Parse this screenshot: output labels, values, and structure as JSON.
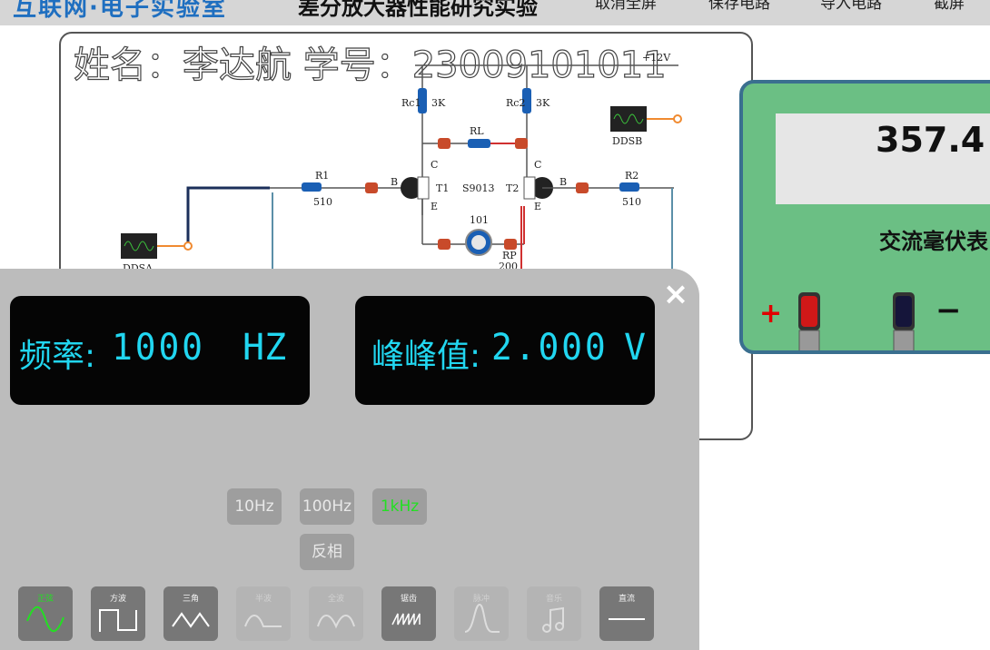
{
  "topbar": {
    "brand": "互联网·电子实验室",
    "experiment_title": "差分放大器性能研究实验",
    "menu": [
      "取消全屏",
      "保存电路",
      "导入电路",
      "截屏"
    ]
  },
  "board": {
    "student_name_label": "姓名：",
    "student_name": "李达航",
    "student_id_label": "学号：",
    "student_id": "23009101011",
    "supply_label": "+12V",
    "components": {
      "rc1": "Rc1",
      "rc1_value": "3K",
      "rc2": "Rc2",
      "rc2_value": "3K",
      "rl": "RL",
      "r1": "R1",
      "r1_value": "510",
      "r2": "R2",
      "r2_value": "510",
      "transistor": "S9013",
      "t1": "T1",
      "t2": "T2",
      "rp": "RP",
      "rp_value": "200",
      "pot_code": "101",
      "b": "B",
      "c": "C",
      "e": "E",
      "ddsa": "DDSA",
      "ddsb": "DDSB"
    }
  },
  "meter": {
    "reading": "357.4",
    "name": "交流毫伏表",
    "plus": "+",
    "minus": "−",
    "colors": {
      "body": "#6bbf84",
      "frame": "#3a6f8f"
    }
  },
  "generator": {
    "close": "×",
    "freq_label": "频率:",
    "freq_value": "1000",
    "freq_unit": "HZ",
    "amp_label": "峰峰值:",
    "amp_value": "2.000",
    "amp_unit": "V",
    "range_buttons": [
      "10Hz",
      "100Hz",
      "1kHz"
    ],
    "active_range": "1kHz",
    "invert_label": "反相",
    "waveforms": [
      {
        "label": "正弦",
        "icon": "sine-wave-icon",
        "state": "active"
      },
      {
        "label": "方波",
        "icon": "square-wave-icon",
        "state": "enabled"
      },
      {
        "label": "三角",
        "icon": "triangle-wave-icon",
        "state": "enabled"
      },
      {
        "label": "半波",
        "icon": "half-wave-icon",
        "state": "disabled"
      },
      {
        "label": "全波",
        "icon": "full-wave-icon",
        "state": "disabled"
      },
      {
        "label": "锯齿",
        "icon": "sawtooth-wave-icon",
        "state": "enabled"
      },
      {
        "label": "脉冲",
        "icon": "pulse-wave-icon",
        "state": "disabled"
      },
      {
        "label": "音乐",
        "icon": "music-icon",
        "state": "disabled"
      },
      {
        "label": "直流",
        "icon": "dc-icon",
        "state": "enabled"
      }
    ],
    "colors": {
      "lcd_text": "#21d6f0",
      "active": "#22e022"
    }
  }
}
